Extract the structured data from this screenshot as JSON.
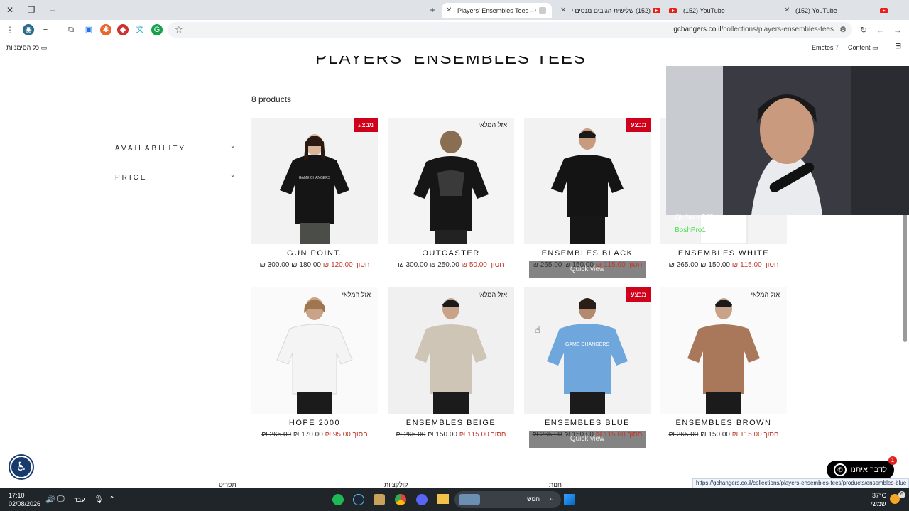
{
  "browser": {
    "tabs": [
      {
        "title": "Players' Ensembles Tees – Game",
        "active": true,
        "icon": "gamechangers-icon"
      },
      {
        "title": "(152) שלישית הגובים מנסים לג...",
        "active": false,
        "icon": "youtube-icon"
      },
      {
        "title": "(152) YouTube",
        "active": false,
        "icon": "youtube-icon"
      },
      {
        "title": "(152) YouTube",
        "active": false,
        "icon": "youtube-icon"
      }
    ],
    "url_domain": "gchangers.co.il",
    "url_path": "/collections/players-ensembles-tees",
    "bookmarks": {
      "all_bookmarks": "כל הסימניות",
      "emotes": "Emotes",
      "content": "Content"
    }
  },
  "page": {
    "title": "PLAYERS' ENSEMBLES TEES",
    "product_count": "8 products",
    "filters": [
      {
        "label": "AVAILABILITY"
      },
      {
        "label": "PRICE"
      }
    ],
    "products": [
      {
        "name": "GUN POINT.",
        "badge": "מבצע",
        "badge_type": "sale",
        "sale_label": "חסוך",
        "sale_amount": "120.00 ₪",
        "price": "180.00 ₪",
        "compare_price": "300.00 ₪",
        "quick_view": ""
      },
      {
        "name": "OUTCASTER",
        "badge": "אזל המלאי",
        "badge_type": "sold",
        "sale_label": "חסוך",
        "sale_amount": "50.00 ₪",
        "price": "250.00 ₪",
        "compare_price": "300.00 ₪",
        "quick_view": ""
      },
      {
        "name": "ENSEMBLES BLACK",
        "badge": "מבצע",
        "badge_type": "sale",
        "sale_label": "חסוך",
        "sale_amount": "115.00 ₪",
        "price": "150.00 ₪",
        "compare_price": "265.00 ₪",
        "quick_view": "Quick view"
      },
      {
        "name": "ENSEMBLES WHITE",
        "badge": "",
        "badge_type": "none",
        "sale_label": "חסוך",
        "sale_amount": "115.00 ₪",
        "price": "150.00 ₪",
        "compare_price": "265.00 ₪",
        "quick_view": ""
      },
      {
        "name": "HOPE 2000",
        "badge": "אזל המלאי",
        "badge_type": "sold",
        "sale_label": "חסוך",
        "sale_amount": "95.00 ₪",
        "price": "170.00 ₪",
        "compare_price": "265.00 ₪",
        "quick_view": ""
      },
      {
        "name": "ENSEMBLES BEIGE",
        "badge": "אזל המלאי",
        "badge_type": "sold",
        "sale_label": "חסוך",
        "sale_amount": "115.00 ₪",
        "price": "150.00 ₪",
        "compare_price": "265.00 ₪",
        "quick_view": ""
      },
      {
        "name": "ENSEMBLES BLUE",
        "badge": "מבצע",
        "badge_type": "sale",
        "sale_label": "חסוך",
        "sale_amount": "115.00 ₪",
        "price": "150.00 ₪",
        "compare_price": "265.00 ₪",
        "quick_view": "Quick view"
      },
      {
        "name": "ENSEMBLES BROWN",
        "badge": "אזל המלאי",
        "badge_type": "sold",
        "sale_label": "חסוך",
        "sale_amount": "115.00 ₪",
        "price": "150.00 ₪",
        "compare_price": "265.00 ₪",
        "quick_view": ""
      }
    ],
    "footer_columns": [
      "תפריט",
      "קולקציות",
      "חנות"
    ],
    "chat_widget": {
      "label": "לדבר איתנו",
      "notifications": "1"
    },
    "status_url": "https://gchangers.co.il/collections/players-ensembles-tees/products/ensembles-blue"
  },
  "stream_overlay": {
    "chat_lines": [
      {
        "text": "@ubuuu248 ...",
        "color": "#ffffff"
      },
      {
        "text": "BoshPro1",
        "color": "#44e14a"
      }
    ]
  },
  "taskbar": {
    "time": "17:10",
    "date": "02/08/2026",
    "language": "עבר",
    "search_placeholder": "חפש",
    "temperature": "37°C",
    "weather_label": "שמשי",
    "notification_count": "6"
  },
  "colors": {
    "sale_badge": "#d0021b",
    "sale_price": "#c0392b",
    "chrome_bg": "#dfe3e8",
    "taskbar_bg": "#1f2529"
  }
}
